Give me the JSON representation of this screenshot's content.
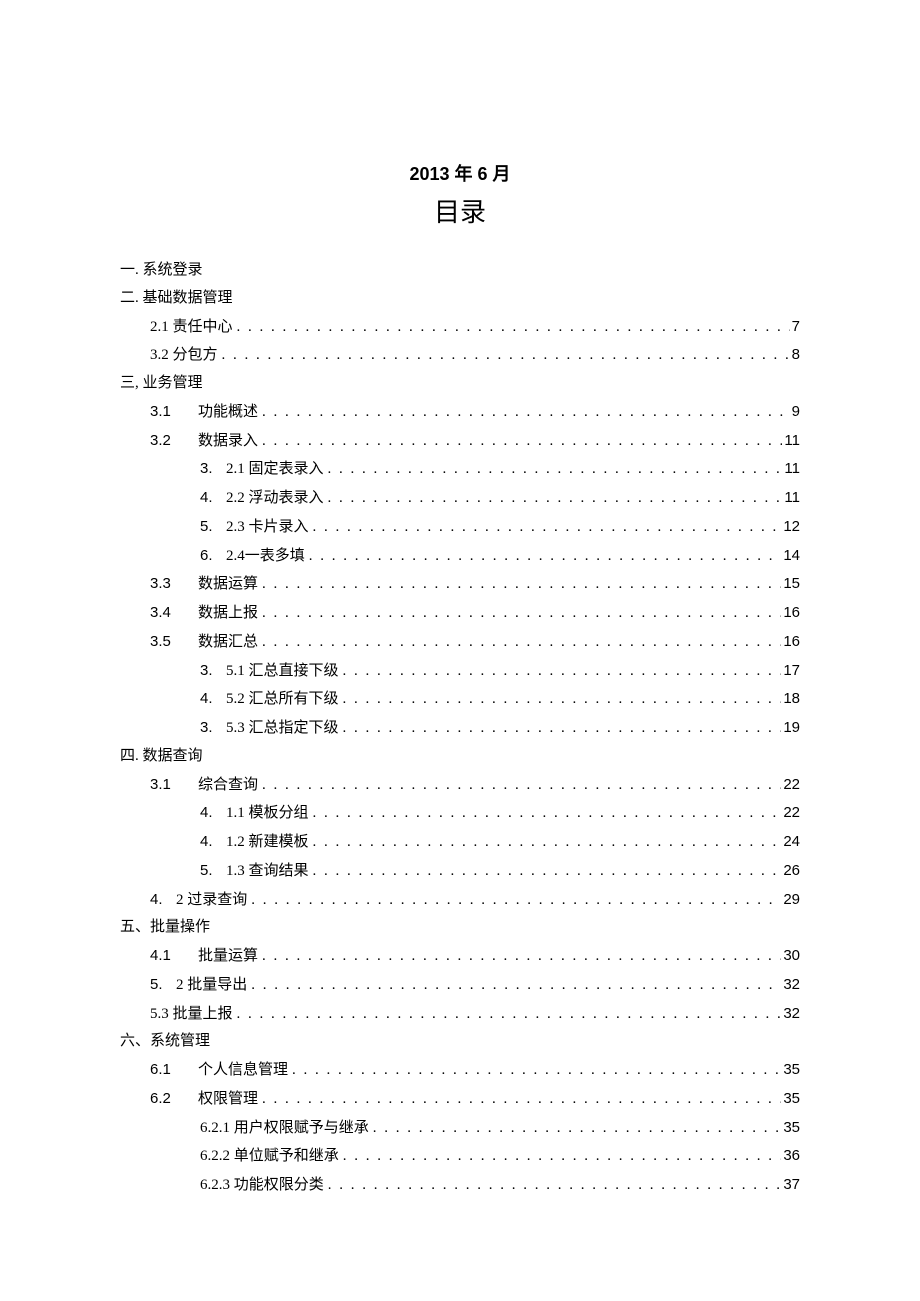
{
  "header": {
    "date": "2013 年 6 月",
    "title": "目录"
  },
  "toc": [
    {
      "indent": 0,
      "num": "",
      "label": "一. 系统登录",
      "page": ""
    },
    {
      "indent": 0,
      "num": "",
      "label": "二. 基础数据管理",
      "page": ""
    },
    {
      "indent": 1,
      "num": "",
      "label": "2.1 责任中心",
      "page": "7",
      "tight": true
    },
    {
      "indent": 1,
      "num": "",
      "label": "3.2 分包方",
      "page": "8",
      "tight": true
    },
    {
      "indent": 0,
      "num": "",
      "label": "三, 业务管理",
      "page": ""
    },
    {
      "indent": 1,
      "num": "3.1",
      "label": "功能概述",
      "page": "9"
    },
    {
      "indent": 1,
      "num": "3.2",
      "label": "数据录入",
      "page": "11"
    },
    {
      "indent": 2,
      "num": "3.",
      "label": "2.1 固定表录入",
      "page": "11"
    },
    {
      "indent": 2,
      "num": "4.",
      "label": "2.2 浮动表录入",
      "page": "11"
    },
    {
      "indent": 2,
      "num": "5.",
      "label": "2.3 卡片录入",
      "page": "12"
    },
    {
      "indent": 2,
      "num": "6.",
      "label": "2.4一表多填",
      "page": "14"
    },
    {
      "indent": 1,
      "num": "3.3",
      "label": "数据运算",
      "page": "15"
    },
    {
      "indent": 1,
      "num": "3.4",
      "label": "数据上报",
      "page": "16"
    },
    {
      "indent": 1,
      "num": "3.5",
      "label": "数据汇总",
      "page": "16"
    },
    {
      "indent": 2,
      "num": "3.",
      "label": "5.1 汇总直接下级",
      "page": "17"
    },
    {
      "indent": 2,
      "num": "4.",
      "label": "5.2 汇总所有下级",
      "page": "18"
    },
    {
      "indent": 2,
      "num": "3.",
      "label": "5.3 汇总指定下级",
      "page": "19"
    },
    {
      "indent": 0,
      "num": "",
      "label": "四. 数据查询",
      "page": ""
    },
    {
      "indent": 1,
      "num": "3.1",
      "label": "综合查询",
      "page": "22"
    },
    {
      "indent": 2,
      "num": "4.",
      "label": "1.1 模板分组",
      "page": "22"
    },
    {
      "indent": 2,
      "num": "4.",
      "label": "1.2 新建模板",
      "page": "24"
    },
    {
      "indent": 2,
      "num": "5.",
      "label": "1.3 查询结果",
      "page": "26"
    },
    {
      "indent": 1,
      "num": "4.",
      "label": "2 过录查询",
      "page": "29",
      "narrownum": true
    },
    {
      "indent": 0,
      "num": "",
      "label": "五、批量操作",
      "page": ""
    },
    {
      "indent": 1,
      "num": "4.1",
      "label": "批量运算",
      "page": "30"
    },
    {
      "indent": 1,
      "num": "5.",
      "label": "2 批量导出",
      "page": "32",
      "narrownum": true
    },
    {
      "indent": 1,
      "num": "",
      "label": "5.3 批量上报",
      "page": "32",
      "tight": true
    },
    {
      "indent": 0,
      "num": "",
      "label": "六、系统管理",
      "page": ""
    },
    {
      "indent": 1,
      "num": "6.1",
      "label": "个人信息管理",
      "page": "35"
    },
    {
      "indent": 1,
      "num": "6.2",
      "label": "权限管理",
      "page": "35"
    },
    {
      "indent": 2,
      "num": "",
      "label": "6.2.1 用户权限赋予与继承",
      "page": "35",
      "tight": true
    },
    {
      "indent": 2,
      "num": "",
      "label": "6.2.2 单位赋予和继承",
      "page": "36",
      "tight": true
    },
    {
      "indent": 2,
      "num": "",
      "label": "6.2.3 功能权限分类",
      "page": "37",
      "tight": true
    }
  ]
}
